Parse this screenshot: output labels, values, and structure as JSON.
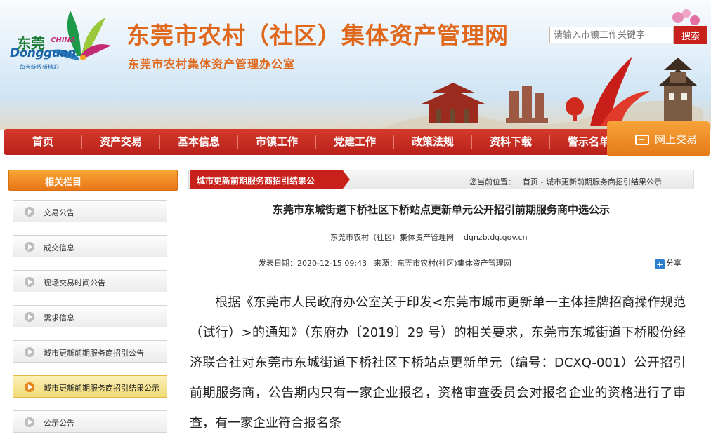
{
  "header": {
    "logo": {
      "brand_cn": "东莞",
      "brand_china": "CHINA",
      "brand_en": "Dongguan",
      "slogan": "每天绽放新精彩"
    },
    "title": "东莞市农村（社区）集体资产管理网",
    "subtitle": "东莞市农村集体资产管理办公室",
    "search": {
      "placeholder": "请输入市镇工作关键字",
      "button_label": "搜索"
    },
    "icons": [
      "landscape-illustration",
      "flower-decoration"
    ]
  },
  "nav": {
    "items": [
      {
        "label": "首页"
      },
      {
        "label": "资产交易"
      },
      {
        "label": "基本信息"
      },
      {
        "label": "市镇工作"
      },
      {
        "label": "党建工作"
      },
      {
        "label": "政策法规"
      },
      {
        "label": "资料下载"
      },
      {
        "label": "警示名单"
      }
    ],
    "online_trade": {
      "label": "网上交易",
      "icon": "computer-icon"
    }
  },
  "sidebar": {
    "header": "相关栏目",
    "items": [
      {
        "label": "交易公告",
        "active": false
      },
      {
        "label": "成交信息",
        "active": false
      },
      {
        "label": "现场交易时间公告",
        "active": false
      },
      {
        "label": "需求信息",
        "active": false
      },
      {
        "label": "城市更新前期服务商招引公告",
        "active": false
      },
      {
        "label": "城市更新前期服务商招引结果公示",
        "active": true
      },
      {
        "label": "公示公告",
        "active": false
      }
    ]
  },
  "content": {
    "tab_label": "城市更新前期服务商招引结果公",
    "breadcrumb": {
      "prefix": "您当前位置：",
      "home": "首页",
      "separator": " - ",
      "current": "城市更新前期服务商招引结果公示"
    },
    "article": {
      "title": "东莞市东城街道下桥社区下桥站点更新单元公开招引前期服务商中选公示",
      "source_name": "东莞市农村（社区）集体资产管理网",
      "source_url": "dgnzb.dg.gov.cn",
      "publish_label": "发表日期：",
      "publish_date": "2020-12-15 09:43",
      "origin_label": "来源：",
      "origin": "东莞市农村(社区)集体资产管理网",
      "share_label": "分享",
      "body": "根据《东莞市人民政府办公室关于印发<东莞市城市更新单一主体挂牌招商操作规范（试行）>的通知》（东府办〔2019〕29 号）的相关要求，东莞市东城街道下桥股份经济联合社对东莞市东城街道下桥社区下桥站点更新单元（编号：DCXQ-001）公开招引前期服务商，公告期内只有一家企业报名，资格审查委员会对报名企业的资格进行了审查，有一家企业符合报名条"
    }
  },
  "colors": {
    "title_orange": "#e0681c",
    "nav_red": "#c8211c",
    "sidebar_orange": "#e77617",
    "active_yellow": "#f2db76"
  }
}
